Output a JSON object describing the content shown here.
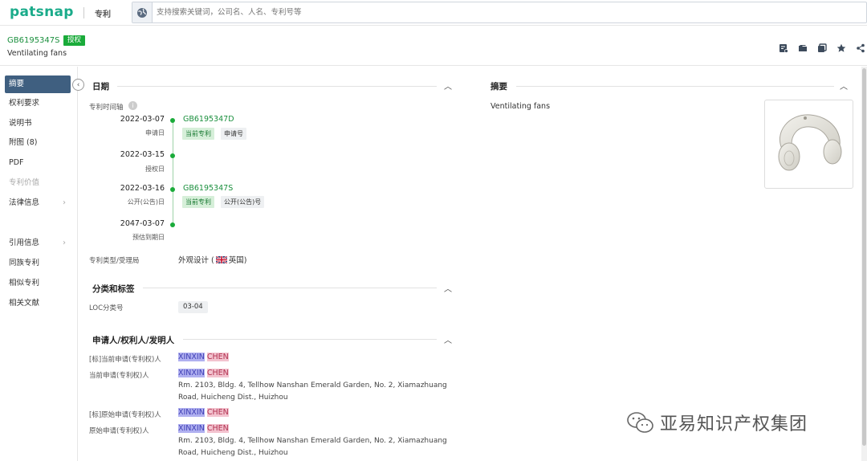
{
  "topbar": {
    "logo": "patsnap",
    "section": "专利",
    "search_placeholder": "支持搜索关键词，公司名、人名、专利号等"
  },
  "header": {
    "patent_number": "GB6195347S",
    "status_badge": "授权",
    "title": "Ventilating fans",
    "icons": [
      "note-icon",
      "folder-icon",
      "copy-icon",
      "star-icon",
      "share-icon"
    ]
  },
  "nav": {
    "items": [
      {
        "label": "摘要",
        "active": true
      },
      {
        "label": "权利要求"
      },
      {
        "label": "说明书"
      },
      {
        "label": "附图 (8)"
      },
      {
        "label": "PDF"
      },
      {
        "label": "专利价值",
        "disabled": true
      },
      {
        "label": "法律信息",
        "chevron": true
      },
      {
        "label": "引用信息",
        "chevron": true
      },
      {
        "label": "同族专利"
      },
      {
        "label": "相似专利"
      },
      {
        "label": "相关文献"
      }
    ]
  },
  "dates_section": {
    "heading": "日期",
    "timeline_label": "专利时间轴",
    "events": [
      {
        "date": "2022-03-07",
        "sub": "申请日",
        "link": "GB6195347D",
        "tags": [
          "当前专利",
          "申请号"
        ]
      },
      {
        "date": "2022-03-15",
        "sub": "授权日"
      },
      {
        "date": "2022-03-16",
        "sub": "公开(公告)日",
        "link": "GB6195347S",
        "tags": [
          "当前专利",
          "公开(公告)号"
        ]
      },
      {
        "date": "2047-03-07",
        "sub": "预估到期日"
      }
    ],
    "type_label": "专利类型/受理局",
    "type_value": "外观设计 (",
    "country": "英国",
    "type_close": ")"
  },
  "classification": {
    "heading": "分类和标签",
    "loc_label": "LOC分类号",
    "loc_value": "03-04"
  },
  "applicants": {
    "heading": "申请人/权利人/发明人",
    "rows": [
      {
        "label": "[标]当前申请(专利权)人",
        "first": "XINXIN",
        "last": "CHEN"
      },
      {
        "label": "当前申请(专利权)人",
        "first": "XINXIN",
        "last": "CHEN",
        "address": "Rm. 2103, Bldg. 4, Tellhow Nanshan Emerald Garden, No. 2, Xiamazhuang Road, Huicheng Dist., Huizhou"
      },
      {
        "label": "[标]原始申请(专利权)人",
        "first": "XINXIN",
        "last": "CHEN"
      },
      {
        "label": "原始申请(专利权)人",
        "first": "XINXIN",
        "last": "CHEN",
        "address": "Rm. 2103, Bldg. 4, Tellhow Nanshan Emerald Garden, No. 2, Xiamazhuang Road, Huicheng Dist., Huizhou"
      }
    ]
  },
  "abstract": {
    "heading": "摘要",
    "text": "Ventilating fans"
  },
  "watermark": {
    "text": "亚易知识产权集团"
  },
  "colors": {
    "brand": "#1aab8a",
    "link_green": "#1a8f3d",
    "badge_green": "#1aab3a",
    "nav_active": "#3f5f80"
  }
}
